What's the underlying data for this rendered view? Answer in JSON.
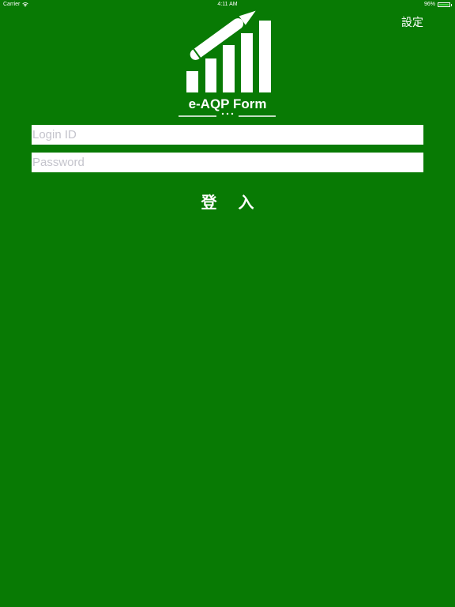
{
  "status_bar": {
    "carrier": "Carrier",
    "time": "4:11 AM",
    "battery": "96%",
    "battery_level": 0.96
  },
  "header": {
    "settings_label": "設定"
  },
  "logo": {
    "text": "e-AQP Form"
  },
  "form": {
    "login_id_placeholder": "Login ID",
    "login_id_value": "",
    "password_placeholder": "Password",
    "password_value": "",
    "login_label": "登 入"
  },
  "colors": {
    "background": "#087a04",
    "foreground": "#ffffff",
    "placeholder": "#c4c4cc",
    "battery_fill": "#3fd23f"
  },
  "icons": {
    "wifi": "wifi-icon",
    "battery": "battery-icon",
    "logo": "bar-chart-pencil-icon"
  }
}
